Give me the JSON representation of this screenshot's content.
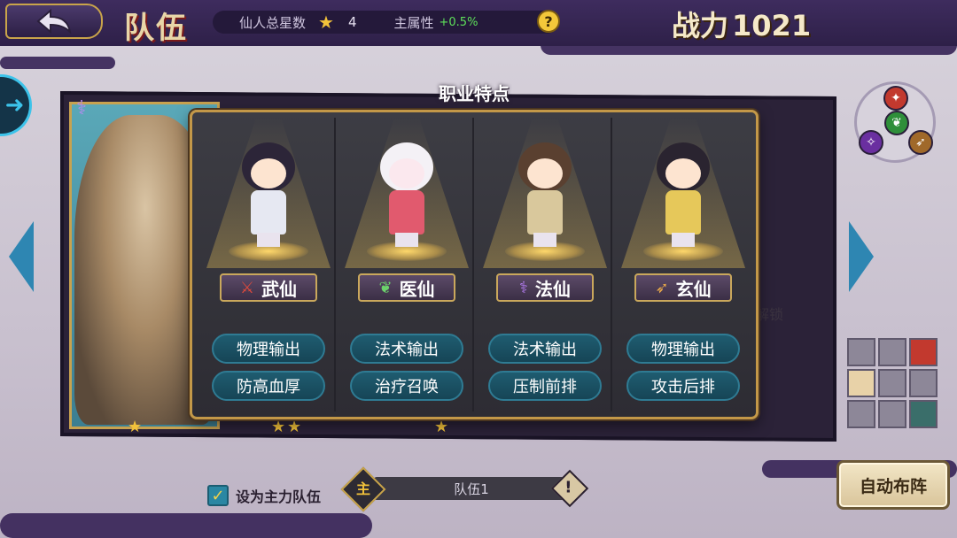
{
  "header": {
    "title": "队伍",
    "star_label": "仙人总星数",
    "star_count": "4",
    "attr_label": "主属性",
    "attr_value": "+0.5%",
    "help_symbol": "?",
    "power_label": "战力",
    "power_value": "1021"
  },
  "popup": {
    "title": "职业特点",
    "classes": [
      {
        "name": "武仙",
        "icon": "sword-icon",
        "traits": [
          "物理输出",
          "防高血厚"
        ],
        "color": "#c2392e"
      },
      {
        "name": "医仙",
        "icon": "herb-icon",
        "traits": [
          "法术输出",
          "治疗召唤"
        ],
        "color": "#2f8f3a"
      },
      {
        "name": "法仙",
        "icon": "staff-icon",
        "traits": [
          "法术输出",
          "压制前排"
        ],
        "color": "#6a2fa0"
      },
      {
        "name": "玄仙",
        "icon": "bow-icon",
        "traits": [
          "物理输出",
          "攻击后排"
        ],
        "color": "#a0692a"
      }
    ]
  },
  "side": {
    "unlock_label": "解锁"
  },
  "bottom": {
    "set_main_label": "设为主力队伍",
    "main_badge": "主",
    "team_name": "队伍1",
    "alert_symbol": "!",
    "auto_button": "自动布阵"
  }
}
